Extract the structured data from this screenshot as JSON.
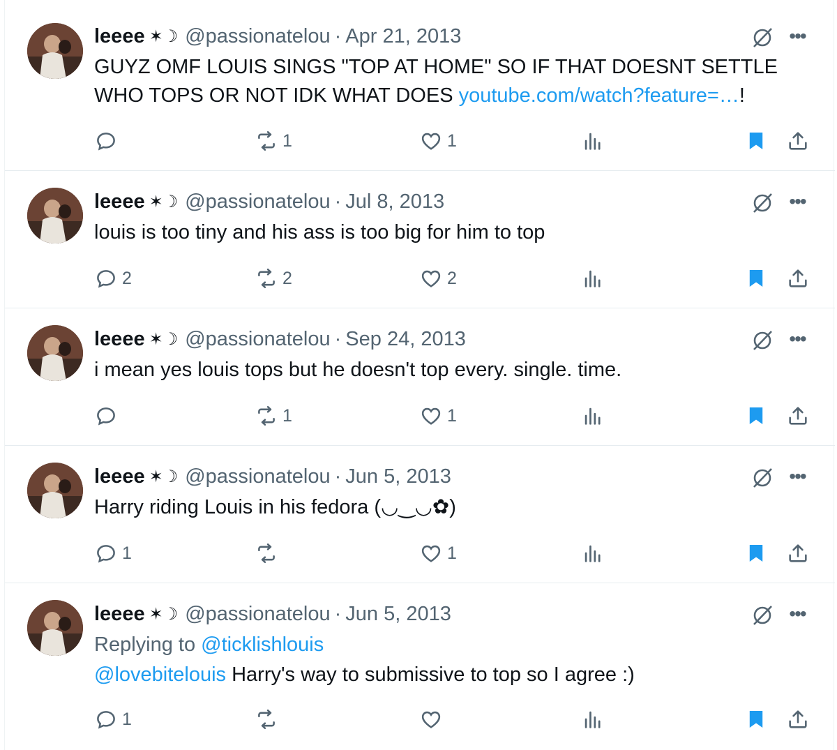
{
  "colors": {
    "accent": "#1d9bf0",
    "secondary_text": "#536471",
    "primary_text": "#0f1419"
  },
  "tweets": [
    {
      "name": "leeee",
      "badge": "✶☽",
      "handle": "@passionatelou",
      "dot": "·",
      "date": "Apr 21, 2013",
      "text": "GUYZ OMF LOUIS SINGS \"TOP AT HOME\" SO IF THAT DOESNT SETTLE WHO TOPS OR NOT IDK WHAT DOES ",
      "link": "youtube.com/watch?feature=…",
      "text_after": "!",
      "replies": "",
      "retweets": "1",
      "likes": "1"
    },
    {
      "name": "leeee",
      "badge": "✶☽",
      "handle": "@passionatelou",
      "dot": "·",
      "date": "Jul 8, 2013",
      "text": "louis is too tiny and his ass is too big for him to top",
      "replies": "2",
      "retweets": "2",
      "likes": "2"
    },
    {
      "name": "leeee",
      "badge": "✶☽",
      "handle": "@passionatelou",
      "dot": "·",
      "date": "Sep 24, 2013",
      "text": "i mean yes louis tops but he doesn't top every. single. time.",
      "replies": "",
      "retweets": "1",
      "likes": "1"
    },
    {
      "name": "leeee",
      "badge": "✶☽",
      "handle": "@passionatelou",
      "dot": "·",
      "date": "Jun 5, 2013",
      "text": "Harry riding Louis in his fedora (◡‿◡✿)",
      "replies": "1",
      "retweets": "",
      "likes": "1"
    },
    {
      "name": "leeee",
      "badge": "✶☽",
      "handle": "@passionatelou",
      "dot": "·",
      "date": "Jun 5, 2013",
      "replying_prefix": "Replying to ",
      "replying_to": "@ticklishlouis",
      "mention": "@lovebitelouis",
      "text": " Harry's way to submissive to top so I agree :)",
      "replies": "1",
      "retweets": "",
      "likes": ""
    }
  ],
  "icons": {
    "reply": "reply-icon",
    "retweet": "retweet-icon",
    "like": "heart-icon",
    "views": "views-icon",
    "bookmark": "bookmark-icon",
    "share": "share-icon",
    "grok": "grok-icon",
    "more": "more-icon"
  }
}
